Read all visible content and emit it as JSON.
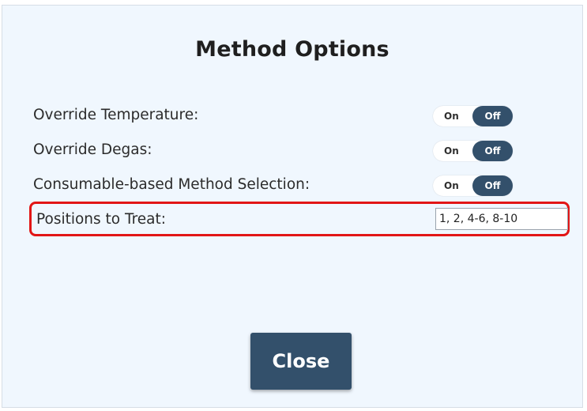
{
  "dialog": {
    "title": "Method Options",
    "options": [
      {
        "label": "Override Temperature:",
        "on_label": "On",
        "off_label": "Off",
        "selected": "Off"
      },
      {
        "label": "Override Degas:",
        "on_label": "On",
        "off_label": "Off",
        "selected": "Off"
      },
      {
        "label": "Consumable-based Method Selection:",
        "on_label": "On",
        "off_label": "Off",
        "selected": "Off"
      }
    ],
    "positions": {
      "label": "Positions to Treat:",
      "value": "1, 2, 4-6, 8-10"
    },
    "close_label": "Close"
  },
  "colors": {
    "background": "#f0f7fe",
    "toggle_active": "#33506b",
    "button": "#33506b",
    "highlight": "#e21616"
  }
}
